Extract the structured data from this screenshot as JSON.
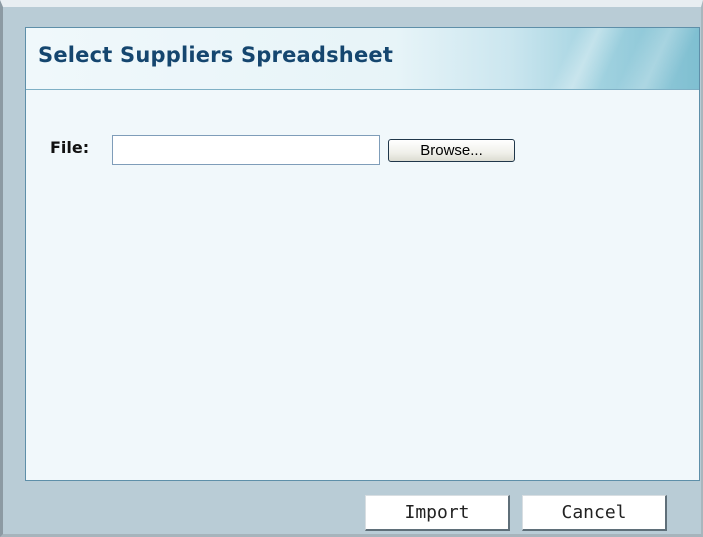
{
  "dialog": {
    "title": "Select Suppliers Spreadsheet"
  },
  "file_field": {
    "label": "File:",
    "value": "",
    "browse_label": "Browse..."
  },
  "actions": {
    "import_label": "Import",
    "cancel_label": "Cancel"
  },
  "colors": {
    "title_text": "#15466f",
    "panel_background": "#f1f8fb",
    "frame_background": "#b9ccd6",
    "title_gradient_end": "#7fbfd1"
  }
}
